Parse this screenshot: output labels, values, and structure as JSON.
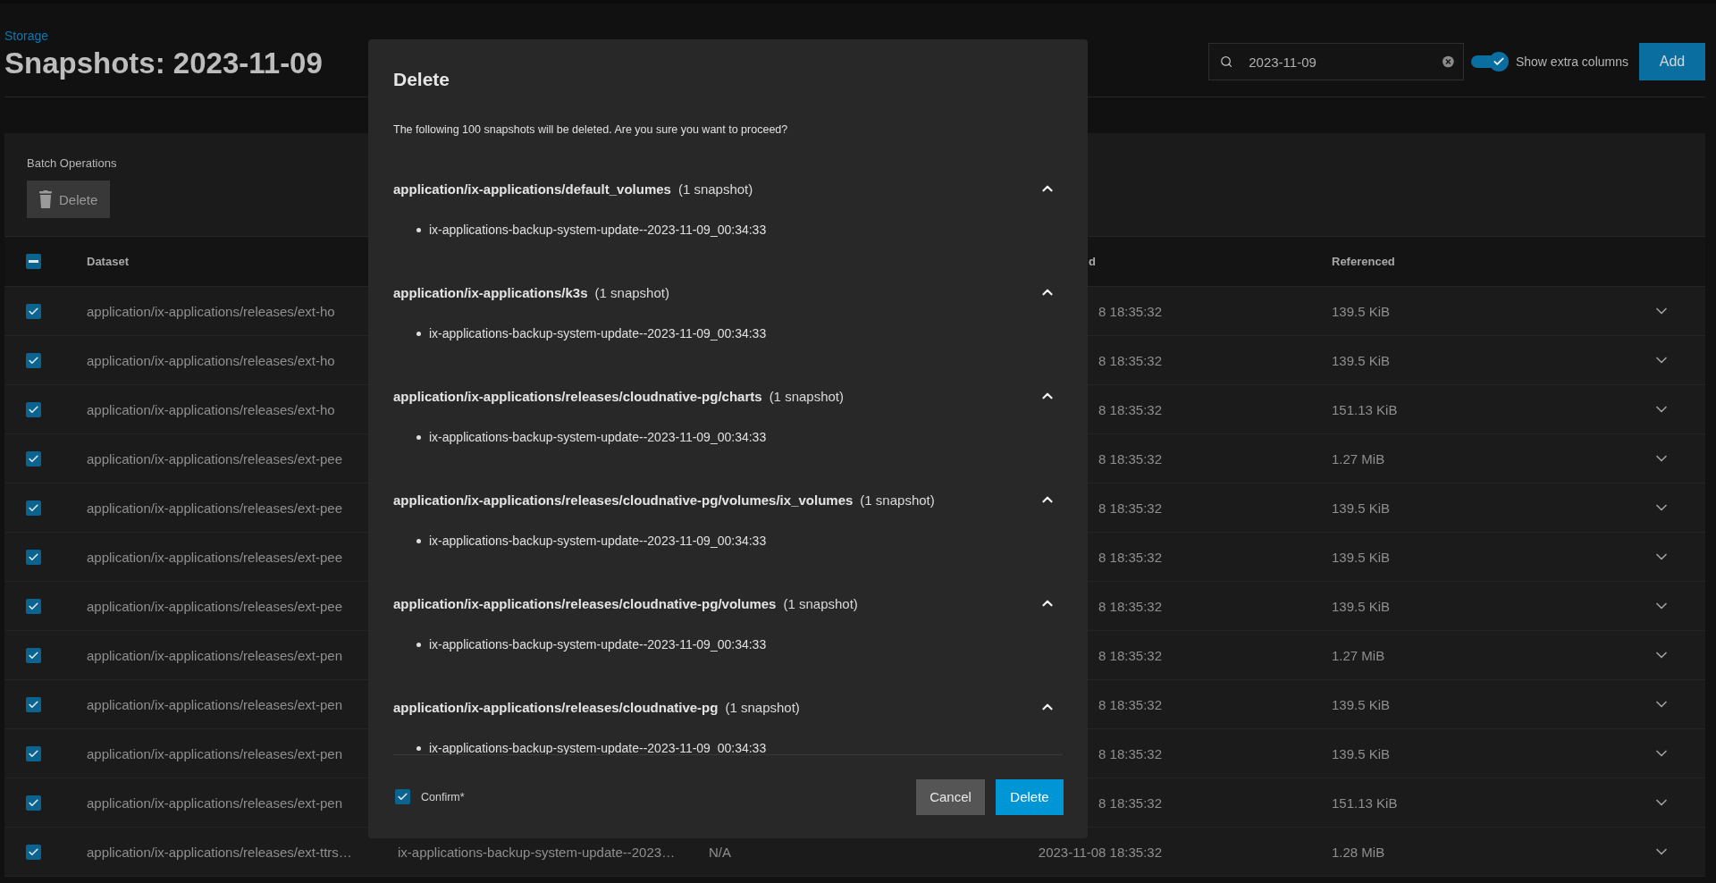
{
  "breadcrumb": "Storage",
  "title": "Snapshots: 2023-11-09",
  "search": {
    "value": "2023-11-09"
  },
  "extra_columns": {
    "label": "Show extra columns",
    "on": true
  },
  "add_button": "Add",
  "batch": {
    "title": "Batch Operations",
    "delete_button": "Delete"
  },
  "table": {
    "select_all": {
      "indeterminate": true
    },
    "columns": [
      "Dataset",
      "d",
      "Referenced"
    ],
    "rows": [
      {
        "checked": true,
        "dataset": "application/ix-applications/releases/ext-ho",
        "created": "8 18:35:32",
        "referenced": "139.5 KiB",
        "expanded": false
      },
      {
        "checked": true,
        "dataset": "application/ix-applications/releases/ext-ho",
        "created": "8 18:35:32",
        "referenced": "139.5 KiB",
        "expanded": false
      },
      {
        "checked": true,
        "dataset": "application/ix-applications/releases/ext-ho",
        "created": "8 18:35:32",
        "referenced": "151.13 KiB",
        "expanded": false
      },
      {
        "checked": true,
        "dataset": "application/ix-applications/releases/ext-pee",
        "created": "8 18:35:32",
        "referenced": "1.27 MiB",
        "expanded": false
      },
      {
        "checked": true,
        "dataset": "application/ix-applications/releases/ext-pee",
        "created": "8 18:35:32",
        "referenced": "139.5 KiB",
        "expanded": false
      },
      {
        "checked": true,
        "dataset": "application/ix-applications/releases/ext-pee",
        "created": "8 18:35:32",
        "referenced": "139.5 KiB",
        "expanded": false
      },
      {
        "checked": true,
        "dataset": "application/ix-applications/releases/ext-pee",
        "created": "8 18:35:32",
        "referenced": "139.5 KiB",
        "expanded": false
      },
      {
        "checked": true,
        "dataset": "application/ix-applications/releases/ext-pen",
        "created": "8 18:35:32",
        "referenced": "1.27 MiB",
        "expanded": false
      },
      {
        "checked": true,
        "dataset": "application/ix-applications/releases/ext-pen",
        "created": "8 18:35:32",
        "referenced": "139.5 KiB",
        "expanded": false
      },
      {
        "checked": true,
        "dataset": "application/ix-applications/releases/ext-pen",
        "created": "8 18:35:32",
        "referenced": "139.5 KiB",
        "expanded": false
      },
      {
        "checked": true,
        "dataset": "application/ix-applications/releases/ext-pen",
        "created": "8 18:35:32",
        "referenced": "151.13 KiB",
        "expanded": false
      },
      {
        "checked": true,
        "dataset": "application/ix-applications/releases/ext-ttrs…",
        "snapshot": "ix-applications-backup-system-update--2023…",
        "used": "N/A",
        "created": "2023-11-08 18:35:32",
        "referenced": "1.28 MiB",
        "expanded": false
      }
    ]
  },
  "dialog": {
    "title": "Delete",
    "message": "The following 100 snapshots will be deleted. Are you sure you want to proceed?",
    "groups": [
      {
        "dataset": "application/ix-applications/default_volumes",
        "count": "(1 snapshot)",
        "expanded": true,
        "items": [
          "ix-applications-backup-system-update--2023-11-09_00:34:33"
        ]
      },
      {
        "dataset": "application/ix-applications/k3s",
        "count": "(1 snapshot)",
        "expanded": true,
        "items": [
          "ix-applications-backup-system-update--2023-11-09_00:34:33"
        ]
      },
      {
        "dataset": "application/ix-applications/releases/cloudnative-pg/charts",
        "count": "(1 snapshot)",
        "expanded": true,
        "items": [
          "ix-applications-backup-system-update--2023-11-09_00:34:33"
        ]
      },
      {
        "dataset": "application/ix-applications/releases/cloudnative-pg/volumes/ix_volumes",
        "count": "(1 snapshot)",
        "expanded": true,
        "items": [
          "ix-applications-backup-system-update--2023-11-09_00:34:33"
        ]
      },
      {
        "dataset": "application/ix-applications/releases/cloudnative-pg/volumes",
        "count": "(1 snapshot)",
        "expanded": true,
        "items": [
          "ix-applications-backup-system-update--2023-11-09_00:34:33"
        ]
      },
      {
        "dataset": "application/ix-applications/releases/cloudnative-pg",
        "count": "(1 snapshot)",
        "expanded": true,
        "items": [
          "ix-applications-backup-system-update--2023-11-09_00:34:33"
        ]
      }
    ],
    "confirm": {
      "label": "Confirm*",
      "checked": true
    },
    "cancel_button": "Cancel",
    "delete_button": "Delete"
  }
}
